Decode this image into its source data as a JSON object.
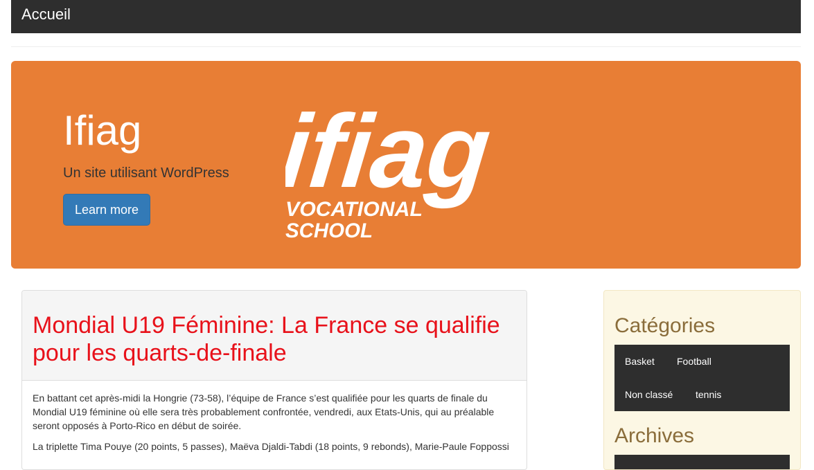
{
  "navbar": {
    "brand": "Accueil"
  },
  "jumbotron": {
    "title": "Ifiag",
    "subtitle": "Un site utilisant WordPress",
    "button_label": "Learn more",
    "background_color": "#e87e35",
    "logo": {
      "wordmark": "ifiag",
      "line1": "VOCATIONAL",
      "line2": "SCHOOL"
    }
  },
  "post": {
    "title": "Mondial U19 Féminine: La France se qualifie pour les quarts-de-finale",
    "paragraphs": [
      "En battant cet après-midi la Hongrie (73-58), l’équipe de France s’est qualifiée pour les quarts de finale du Mondial U19 féminine où elle sera très probablement confrontée, vendredi, aux Etats-Unis, qui au préalable seront opposés à Porto-Rico en début de soirée.",
      "La triplette Tima Pouye (20 points, 5 passes), Maëva Djaldi-Tabdi (18 points, 9 rebonds), Marie-Paule Foppossi"
    ],
    "title_color": "#e8111a"
  },
  "sidebar": {
    "categories_title": "Catégories",
    "categories": [
      "Basket",
      "Football",
      "Non classé",
      "tennis"
    ],
    "archives_title": "Archives"
  }
}
